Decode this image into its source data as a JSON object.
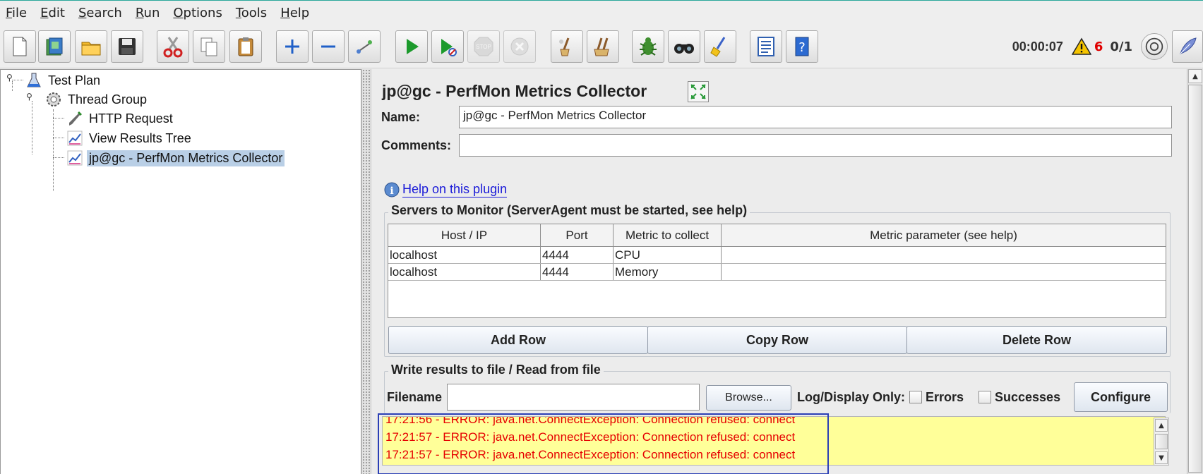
{
  "menubar": {
    "items": [
      {
        "label": "File",
        "mnemonic": "F",
        "rest": "ile"
      },
      {
        "label": "Edit",
        "mnemonic": "E",
        "rest": "dit"
      },
      {
        "label": "Search",
        "mnemonic": "S",
        "rest": "earch"
      },
      {
        "label": "Run",
        "mnemonic": "R",
        "rest": "un"
      },
      {
        "label": "Options",
        "mnemonic": "O",
        "rest": "ptions"
      },
      {
        "label": "Tools",
        "mnemonic": "T",
        "rest": "ools"
      },
      {
        "label": "Help",
        "mnemonic": "H",
        "rest": "elp"
      }
    ]
  },
  "toolbar": {
    "timer": "00:00:07",
    "error_count": "6",
    "threads": "0/1",
    "icons": [
      "new-icon",
      "templates-icon",
      "open-icon",
      "save-icon",
      "cut-icon",
      "copy-icon",
      "paste-icon",
      "expand-icon",
      "collapse-icon",
      "toggle-icon",
      "start-icon",
      "start-no-pauses-icon",
      "stop-icon",
      "shutdown-icon",
      "clear-icon",
      "clear-all-icon",
      "function-helper-icon",
      "search-icon",
      "reset-search-icon",
      "log-viewer-icon",
      "help-icon"
    ],
    "colors": {
      "error": "#e00000",
      "warning": "#f0c000"
    }
  },
  "tree": {
    "nodes": [
      {
        "label": "Test Plan",
        "icon": "test-plan-icon"
      },
      {
        "label": "Thread Group",
        "icon": "thread-group-icon"
      },
      {
        "label": "HTTP Request",
        "icon": "http-request-icon"
      },
      {
        "label": "View Results Tree",
        "icon": "listener-icon"
      },
      {
        "label": "jp@gc - PerfMon Metrics Collector",
        "icon": "listener-icon",
        "selected": true
      }
    ]
  },
  "main": {
    "title": "jp@gc - PerfMon Metrics Collector",
    "name_label": "Name:",
    "name_value": "jp@gc - PerfMon Metrics Collector",
    "comments_label": "Comments:",
    "comments_value": "",
    "help_link": "Help on this plugin",
    "servers_group_title": "Servers to Monitor (ServerAgent must be started, see help)",
    "table": {
      "columns": [
        "Host / IP",
        "Port",
        "Metric to collect",
        "Metric parameter (see help)"
      ],
      "rows": [
        [
          "localhost",
          "4444",
          "CPU",
          ""
        ],
        [
          "localhost",
          "4444",
          "Memory",
          ""
        ]
      ]
    },
    "buttons": {
      "add_row": "Add Row",
      "copy_row": "Copy Row",
      "delete_row": "Delete Row"
    },
    "file_group_title": "Write results to file / Read from file",
    "filename_label": "Filename",
    "filename_value": "",
    "browse_label": "Browse...",
    "log_display_label": "Log/Display Only:",
    "errors_label": "Errors",
    "successes_label": "Successes",
    "configure_label": "Configure",
    "log_lines": [
      "17:21:56 - ERROR: java.net.ConnectException: Connection refused: connect",
      "17:21:57 - ERROR: java.net.ConnectException: Connection refused: connect",
      "17:21:57 - ERROR: java.net.ConnectException: Connection refused: connect"
    ],
    "colors": {
      "log_bg": "#ffff99",
      "log_text": "#e60000",
      "link": "#1a1ad8",
      "highlight": "#2b3fb5"
    }
  }
}
